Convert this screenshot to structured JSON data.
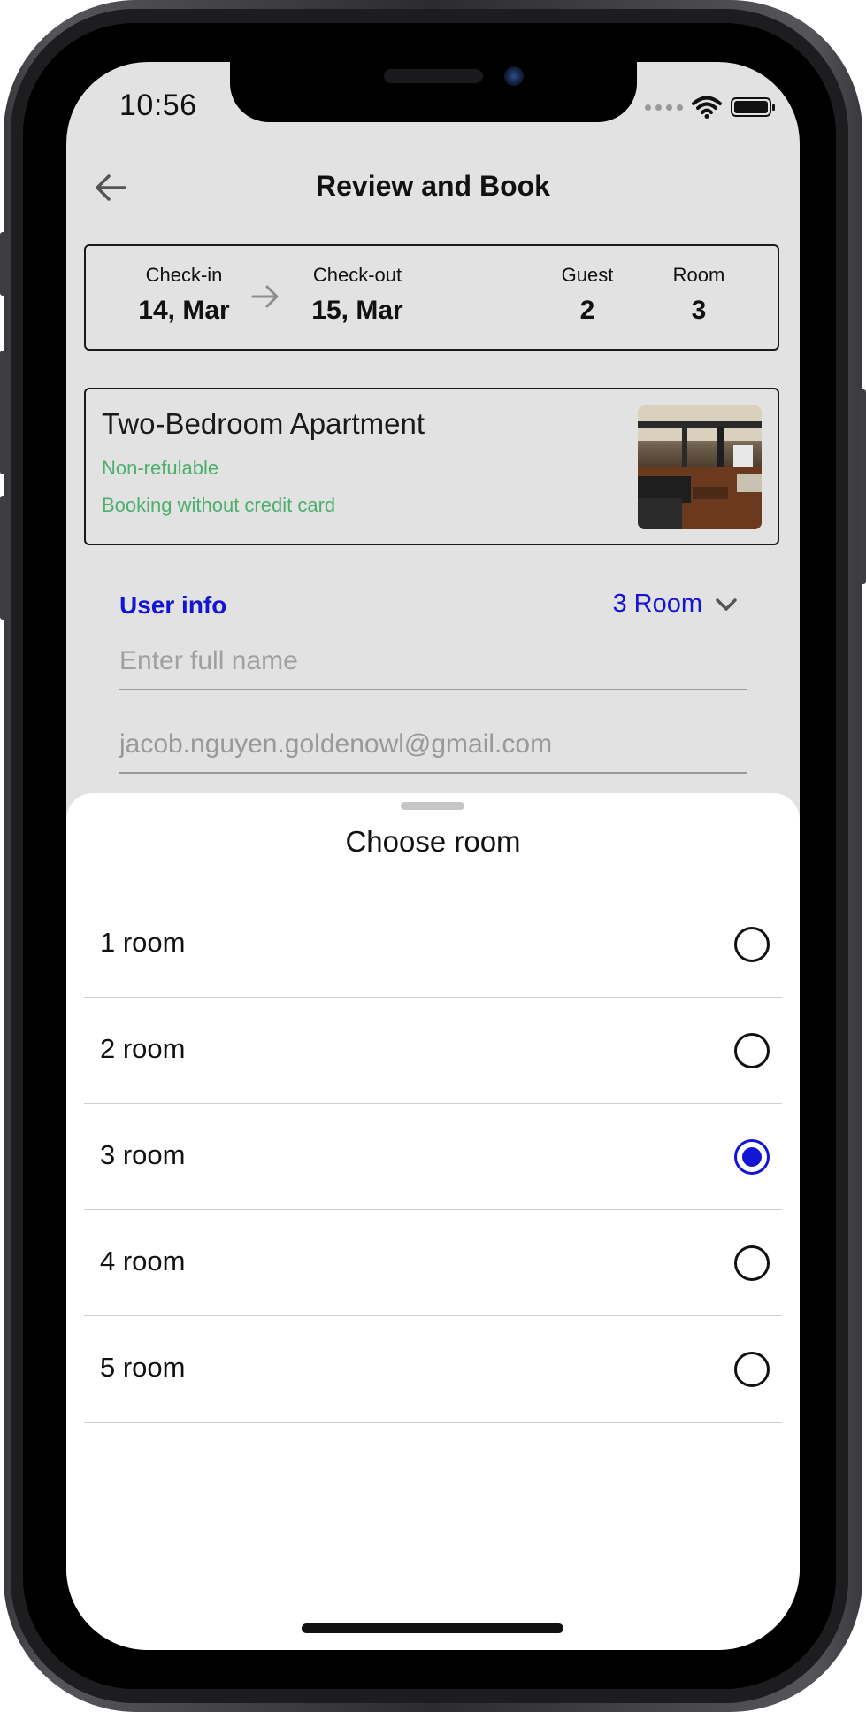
{
  "status_bar": {
    "time": "10:56"
  },
  "header": {
    "title": "Review and Book"
  },
  "summary": {
    "checkin_label": "Check-in",
    "checkin_value": "14, Mar",
    "checkout_label": "Check-out",
    "checkout_value": "15, Mar",
    "guest_label": "Guest",
    "guest_value": "2",
    "room_label": "Room",
    "room_value": "3"
  },
  "room_card": {
    "name": "Two-Bedroom Apartment",
    "tag1": "Non-refulable",
    "tag2": "Booking without credit card"
  },
  "user_info": {
    "label": "User info",
    "room_select": "3 Room",
    "full_name_placeholder": "Enter full name",
    "email_value": "jacob.nguyen.goldenowl@gmail.com"
  },
  "sheet": {
    "title": "Choose room",
    "options": [
      {
        "label": "1 room",
        "selected": false
      },
      {
        "label": "2 room",
        "selected": false
      },
      {
        "label": "3 room",
        "selected": true
      },
      {
        "label": "4 room",
        "selected": false
      },
      {
        "label": "5 room",
        "selected": false
      }
    ]
  },
  "colors": {
    "accent": "#1414d4",
    "tag_green": "#4caf6e",
    "screen_bg": "#e2e2e2"
  }
}
